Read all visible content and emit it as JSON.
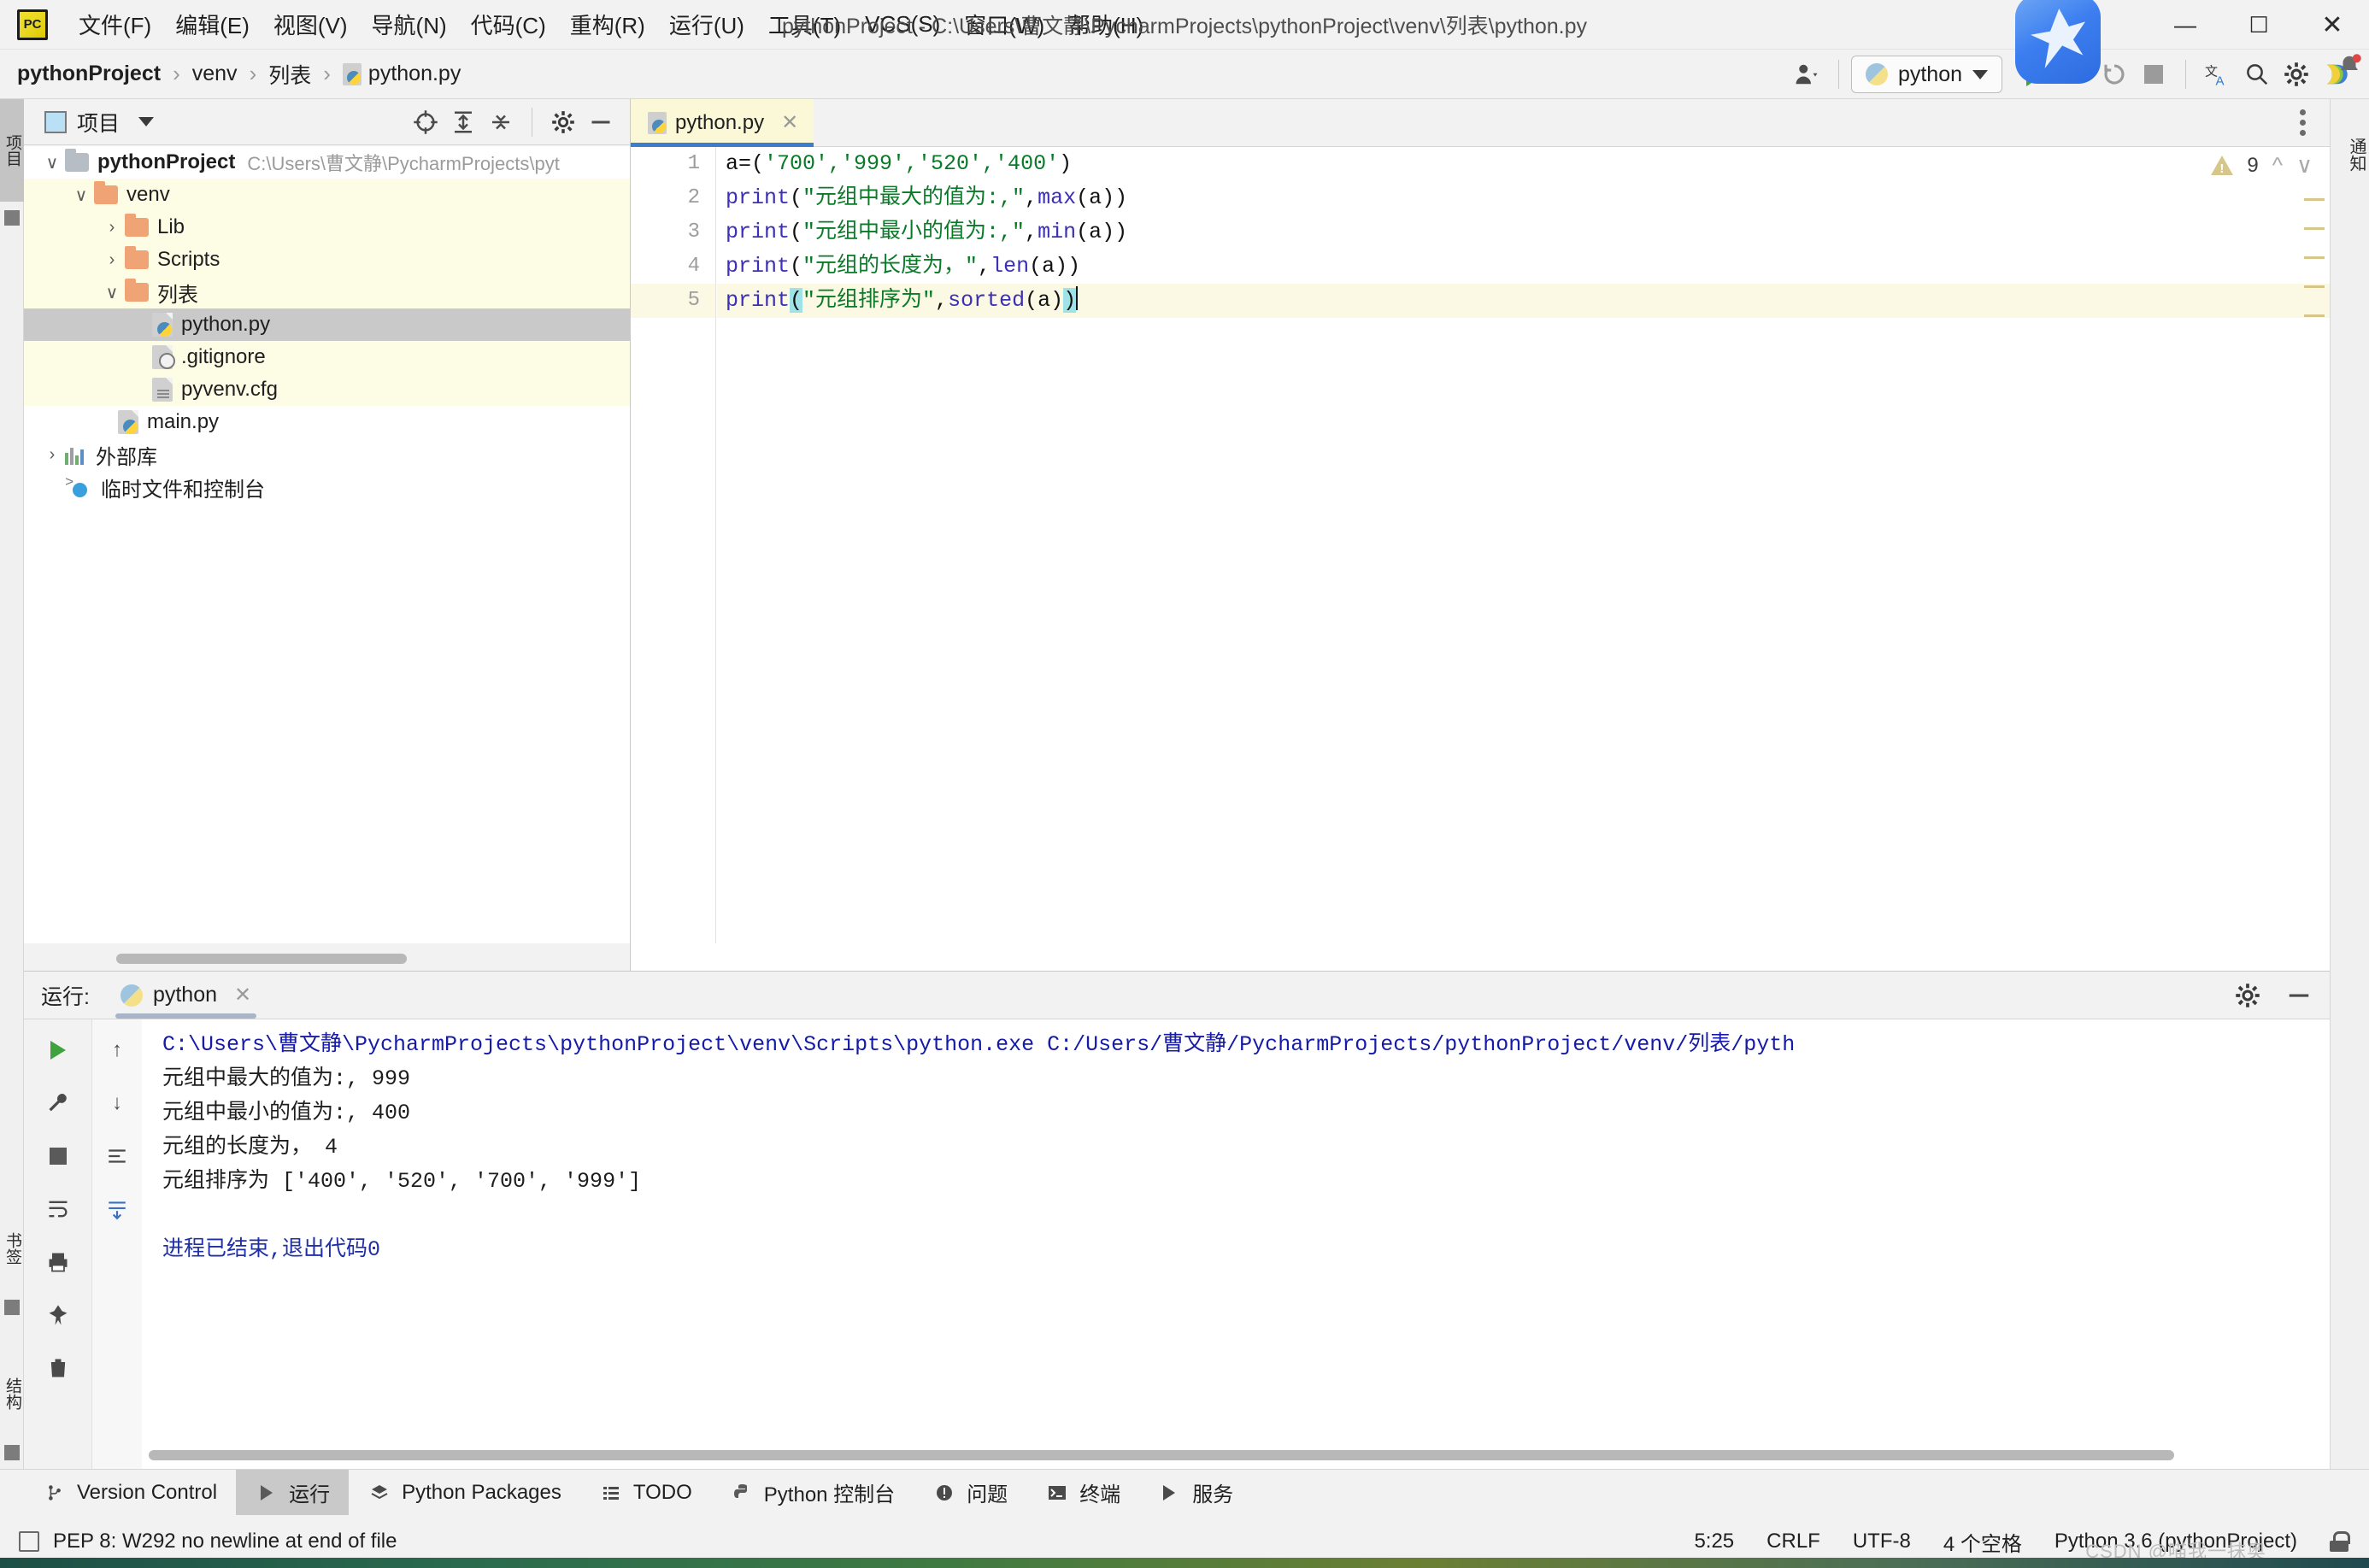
{
  "window": {
    "title": "pythonProject - C:\\Users\\曹文静\\PycharmProjects\\pythonProject\\venv\\列表\\python.py",
    "logo_text": "PC",
    "minimize": "—",
    "maximize": "☐",
    "close": "✕"
  },
  "menu": [
    {
      "label": "文件(F)"
    },
    {
      "label": "编辑(E)"
    },
    {
      "label": "视图(V)"
    },
    {
      "label": "导航(N)"
    },
    {
      "label": "代码(C)"
    },
    {
      "label": "重构(R)"
    },
    {
      "label": "运行(U)"
    },
    {
      "label": "工具(T)"
    },
    {
      "label": "VCS(S)"
    },
    {
      "label": "窗口(W)"
    },
    {
      "label": "帮助(H)"
    }
  ],
  "breadcrumb": {
    "sep": "›",
    "items": [
      "pythonProject",
      "venv",
      "列表",
      "python.py"
    ]
  },
  "toolbar": {
    "run_config_label": "python",
    "search_icon": "search-icon",
    "settings_icon": "gear-icon",
    "translate_icon": "translate-icon"
  },
  "project_panel": {
    "title": "项目",
    "tree": [
      {
        "name": "pythonProject",
        "path": "C:\\Users\\曹文静\\PycharmProjects\\pyt",
        "indent": 0,
        "twisty": "∨",
        "icon": "folder-gray",
        "bold": true,
        "state": "normal"
      },
      {
        "name": "venv",
        "path": "",
        "indent": 1,
        "twisty": "∨",
        "icon": "folder",
        "bold": false,
        "state": "scope"
      },
      {
        "name": "Lib",
        "path": "",
        "indent": 2,
        "twisty": "›",
        "icon": "folder",
        "bold": false,
        "state": "scope"
      },
      {
        "name": "Scripts",
        "path": "",
        "indent": 2,
        "twisty": "›",
        "icon": "folder",
        "bold": false,
        "state": "scope"
      },
      {
        "name": "列表",
        "path": "",
        "indent": 2,
        "twisty": "∨",
        "icon": "folder",
        "bold": false,
        "state": "scope"
      },
      {
        "name": "python.py",
        "path": "",
        "indent": 3,
        "twisty": "",
        "icon": "file-py",
        "bold": false,
        "state": "selected"
      },
      {
        "name": ".gitignore",
        "path": "",
        "indent": 3,
        "twisty": "",
        "icon": "file-git",
        "bold": false,
        "state": "scope"
      },
      {
        "name": "pyvenv.cfg",
        "path": "",
        "indent": 3,
        "twisty": "",
        "icon": "file-cfg",
        "bold": false,
        "state": "scope"
      },
      {
        "name": "main.py",
        "path": "",
        "indent": 2,
        "twisty": "",
        "icon": "file-py",
        "bold": false,
        "state": "normal"
      },
      {
        "name": "外部库",
        "path": "",
        "indent": 0,
        "twisty": "›",
        "icon": "library",
        "bold": false,
        "state": "normal"
      },
      {
        "name": "临时文件和控制台",
        "path": "",
        "indent": 0,
        "twisty": "",
        "icon": "scratch",
        "bold": false,
        "state": "normal"
      }
    ]
  },
  "editor": {
    "tab_label": "python.py",
    "tab_close": "✕",
    "warning_count": "9",
    "line_numbers": [
      "1",
      "2",
      "3",
      "4",
      "5"
    ],
    "code": [
      {
        "n": "1",
        "segments": [
          {
            "t": "a=(",
            "c": "norm"
          },
          {
            "t": "'700','999','520','400'",
            "c": "str"
          },
          {
            "t": ")",
            "c": "norm"
          }
        ]
      },
      {
        "n": "2",
        "segments": [
          {
            "t": "print",
            "c": "func"
          },
          {
            "t": "(",
            "c": "norm"
          },
          {
            "t": "\"元组中最大的值为:,\"",
            "c": "str"
          },
          {
            "t": ",",
            "c": "norm"
          },
          {
            "t": "max",
            "c": "func"
          },
          {
            "t": "(a))",
            "c": "norm"
          }
        ]
      },
      {
        "n": "3",
        "segments": [
          {
            "t": "print",
            "c": "func"
          },
          {
            "t": "(",
            "c": "norm"
          },
          {
            "t": "\"元组中最小的值为:,\"",
            "c": "str"
          },
          {
            "t": ",",
            "c": "norm"
          },
          {
            "t": "min",
            "c": "func"
          },
          {
            "t": "(a))",
            "c": "norm"
          }
        ]
      },
      {
        "n": "4",
        "segments": [
          {
            "t": "print",
            "c": "func"
          },
          {
            "t": "(",
            "c": "norm"
          },
          {
            "t": "\"元组的长度为，\"",
            "c": "str"
          },
          {
            "t": ",",
            "c": "norm"
          },
          {
            "t": "len",
            "c": "func"
          },
          {
            "t": "(a))",
            "c": "norm"
          }
        ]
      },
      {
        "n": "5",
        "segments": [
          {
            "t": "print",
            "c": "func"
          },
          {
            "t": "(",
            "c": "brace"
          },
          {
            "t": "\"元组排序为\"",
            "c": "str"
          },
          {
            "t": ",",
            "c": "norm"
          },
          {
            "t": "sorted",
            "c": "func"
          },
          {
            "t": "(a)",
            "c": "norm"
          },
          {
            "t": ")",
            "c": "brace"
          }
        ]
      }
    ]
  },
  "run_panel": {
    "label": "运行:",
    "tab_label": "python",
    "tab_close": "✕",
    "output": [
      {
        "text": "C:\\Users\\曹文静\\PycharmProjects\\pythonProject\\venv\\Scripts\\python.exe C:/Users/曹文静/PycharmProjects/pythonProject/venv/列表/pyth",
        "style": "cmd"
      },
      {
        "text": "元组中最大的值为:, 999",
        "style": "normal"
      },
      {
        "text": "元组中最小的值为:, 400",
        "style": "normal"
      },
      {
        "text": "元组的长度为， 4",
        "style": "normal"
      },
      {
        "text": "元组排序为 ['400', '520', '700', '999']",
        "style": "normal"
      },
      {
        "text": "",
        "style": "normal"
      },
      {
        "text": "进程已结束,退出代码0",
        "style": "exit"
      }
    ]
  },
  "bottom_tabs": [
    {
      "label": "Version Control",
      "icon": "branch-icon",
      "active": false
    },
    {
      "label": "运行",
      "icon": "play-icon",
      "active": true
    },
    {
      "label": "Python Packages",
      "icon": "stack-icon",
      "active": false
    },
    {
      "label": "TODO",
      "icon": "list-icon",
      "active": false
    },
    {
      "label": "Python 控制台",
      "icon": "python-icon",
      "active": false
    },
    {
      "label": "问题",
      "icon": "alert-icon",
      "active": false
    },
    {
      "label": "终端",
      "icon": "terminal-icon",
      "active": false
    },
    {
      "label": "服务",
      "icon": "services-icon",
      "active": false
    }
  ],
  "left_strip": [
    {
      "label": "项目",
      "active": true
    },
    {
      "label": "书签",
      "active": false
    },
    {
      "label": "结构",
      "active": false
    }
  ],
  "right_strip": [
    {
      "label": "通知",
      "active": false
    }
  ],
  "status_bar": {
    "message": "PEP 8: W292 no newline at end of file",
    "caret": "5:25",
    "line_sep": "CRLF",
    "encoding": "UTF-8",
    "indent": "4 个空格",
    "interpreter": "Python 3.6 (pythonProject)"
  },
  "watermark": "CSDN @喵我一抹奥"
}
